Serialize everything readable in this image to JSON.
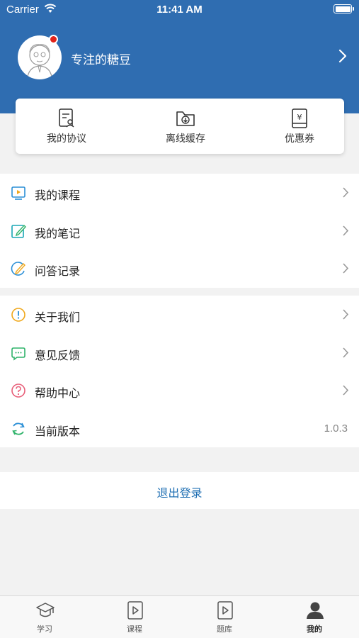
{
  "status_bar": {
    "carrier": "Carrier",
    "time": "11:41 AM"
  },
  "profile": {
    "nickname": "专注的糖豆"
  },
  "quick_actions": [
    {
      "label": "我的协议",
      "icon": "agreement-icon"
    },
    {
      "label": "离线缓存",
      "icon": "offline-cache-icon"
    },
    {
      "label": "优惠券",
      "icon": "coupon-icon"
    }
  ],
  "menu_group_1": [
    {
      "label": "我的课程",
      "icon": "course-icon",
      "color": "#2b8fd6"
    },
    {
      "label": "我的笔记",
      "icon": "note-icon",
      "color": "#19a7b5"
    },
    {
      "label": "问答记录",
      "icon": "qa-record-icon",
      "color": "#2b8fd6"
    }
  ],
  "menu_group_2": [
    {
      "label": "关于我们",
      "icon": "about-icon",
      "color": "#f0a81c"
    },
    {
      "label": "意见反馈",
      "icon": "feedback-icon",
      "color": "#2fb36a"
    },
    {
      "label": "帮助中心",
      "icon": "help-icon",
      "color": "#e8607a"
    },
    {
      "label": "当前版本",
      "icon": "version-icon",
      "color": "#2b8fd6",
      "value": "1.0.3"
    }
  ],
  "logout_label": "退出登录",
  "tabs": [
    {
      "label": "学习",
      "icon": "study-icon",
      "active": false
    },
    {
      "label": "课程",
      "icon": "course-play-icon",
      "active": false
    },
    {
      "label": "题库",
      "icon": "question-bank-icon",
      "active": false
    },
    {
      "label": "我的",
      "icon": "profile-icon",
      "active": true
    }
  ],
  "colors": {
    "header": "#2f6db1",
    "accent": "#1f6fb3",
    "badge": "#e2231a"
  }
}
